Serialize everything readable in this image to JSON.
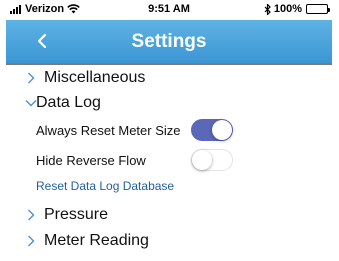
{
  "status_bar": {
    "carrier": "Verizon",
    "time": "9:51 AM",
    "battery": "100%"
  },
  "nav": {
    "title": "Settings",
    "back_icon": "chevron-left-icon"
  },
  "sections": [
    {
      "label": "Miscellaneous",
      "expanded": false
    },
    {
      "label": "Data Log",
      "expanded": true
    },
    {
      "label": "Pressure",
      "expanded": false
    },
    {
      "label": "Meter Reading",
      "expanded": false
    }
  ],
  "data_log": {
    "always_reset_meter_size": {
      "label": "Always Reset Meter Size",
      "on": true
    },
    "hide_reverse_flow": {
      "label": "Hide Reverse Flow",
      "on": false
    },
    "reset_link": "Reset Data Log Database"
  },
  "colors": {
    "nav": "#4aa6dc",
    "toggle_on": "#5b67b8",
    "link": "#1f5f9c",
    "chevron": "#4a90d9"
  }
}
